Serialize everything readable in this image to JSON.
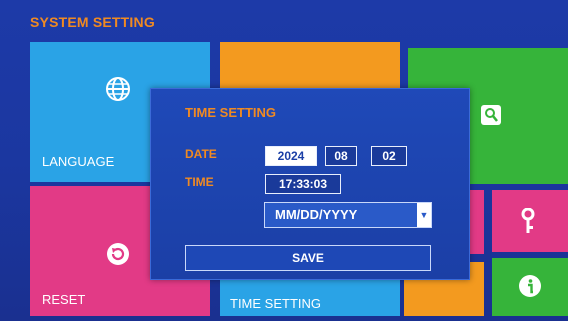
{
  "screen": {
    "title": "SYSTEM SETTING"
  },
  "tiles": {
    "language_label": "LANGUAGE",
    "reset_label": "RESET",
    "time_setting_label": "TIME SETTING"
  },
  "dialog": {
    "title": "TIME SETTING",
    "date_label": "DATE",
    "time_label": "TIME",
    "year": "2024",
    "month": "08",
    "day": "02",
    "time": "17:33:03",
    "date_format": "MM/DD/YYYY",
    "save_label": "SAVE"
  },
  "icons": [
    "globe-icon",
    "reset-icon",
    "storage-search-icon",
    "key-icon",
    "info-icon",
    "chevron-down-icon"
  ],
  "colors": {
    "accent_orange": "#f08a22",
    "tile_blue": "#2aa3e6",
    "tile_pink": "#e23a86",
    "tile_green": "#36b43a",
    "tile_orange": "#f39a1f"
  }
}
